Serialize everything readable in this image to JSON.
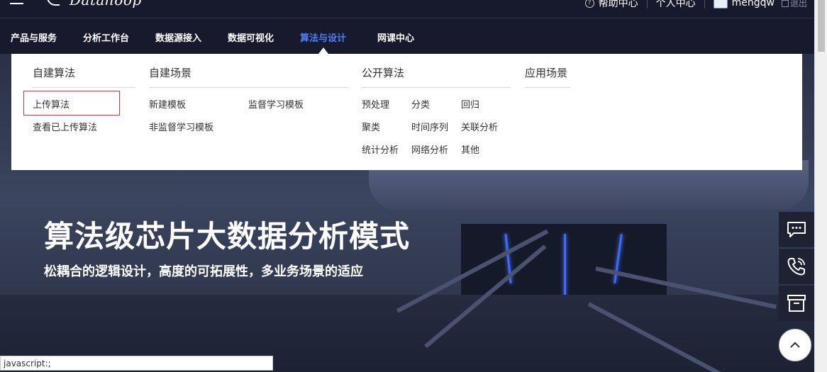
{
  "top": {
    "logo": "Datahoop",
    "help": "帮助中心",
    "personal": "个人中心",
    "username": "mengqw",
    "logout": "退出"
  },
  "nav": {
    "items": [
      {
        "label": "产品与服务"
      },
      {
        "label": "分析工作台"
      },
      {
        "label": "数据源接入"
      },
      {
        "label": "数据可视化"
      },
      {
        "label": "算法与设计"
      },
      {
        "label": "网课中心"
      }
    ],
    "active_index": 4,
    "active_color": "#4e80f5"
  },
  "dropdown": {
    "columns": {
      "self_built": {
        "title": "自建算法",
        "links": [
          "上传算法",
          "查看已上传算法"
        ]
      },
      "self_scene": {
        "title": "自建场景",
        "links": [
          "新建模板",
          "监督学习模板",
          "非监督学习模板"
        ]
      },
      "public": {
        "title": "公开算法",
        "links": [
          "预处理",
          "分类",
          "回归",
          "聚类",
          "时间序列",
          "关联分析",
          "统计分析",
          "网络分析",
          "其他"
        ]
      },
      "apps": {
        "title": "应用场景"
      }
    },
    "highlight_color": "#d9363e"
  },
  "hero": {
    "title": "算法级芯片大数据分析模式",
    "subtitle": "松耦合的逻辑设计，高度的可拓展性，多业务场景的适应"
  },
  "side_buttons": [
    "chat-icon",
    "phone-icon",
    "archive-icon"
  ],
  "status_url": "javascript:;"
}
